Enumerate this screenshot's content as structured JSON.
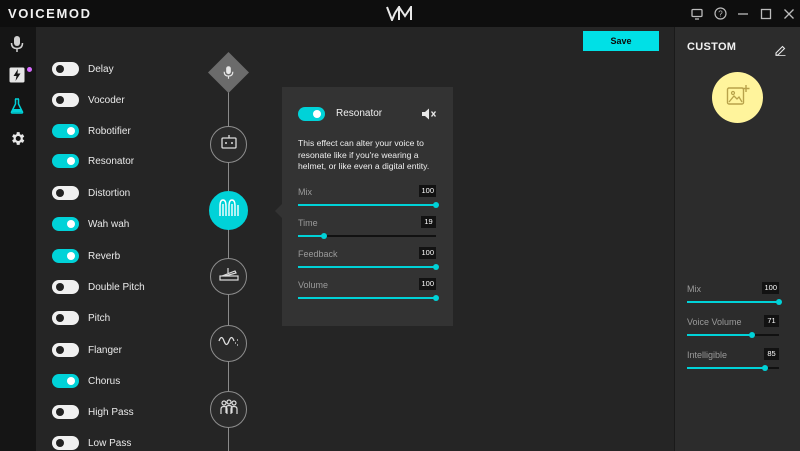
{
  "titlebar": {
    "brand": "VOICEMOD",
    "center_logo": "vm-logo-icon",
    "icons": [
      "screen-icon",
      "help-icon",
      "minimize-icon",
      "maximize-icon",
      "close-icon"
    ]
  },
  "rail": {
    "icons": [
      "microphone-icon",
      "soundboard-lightning-icon",
      "voicelab-flask-icon",
      "settings-gear-icon"
    ],
    "active": "voicelab-flask-icon"
  },
  "effects": [
    {
      "label": "Delay",
      "on": false
    },
    {
      "label": "Vocoder",
      "on": false
    },
    {
      "label": "Robotifier",
      "on": true
    },
    {
      "label": "Resonator",
      "on": true
    },
    {
      "label": "Distortion",
      "on": false
    },
    {
      "label": "Wah wah",
      "on": true
    },
    {
      "label": "Reverb",
      "on": true
    },
    {
      "label": "Double Pitch",
      "on": false
    },
    {
      "label": "Pitch",
      "on": false
    },
    {
      "label": "Flanger",
      "on": false
    },
    {
      "label": "Chorus",
      "on": true
    },
    {
      "label": "High Pass",
      "on": false
    },
    {
      "label": "Low Pass",
      "on": false
    }
  ],
  "chain": {
    "nodes": [
      "microphone-icon",
      "robot-icon",
      "resonator-icon",
      "wah-pedal-icon",
      "reverb-wave-icon",
      "chorus-people-icon"
    ],
    "active": "resonator-icon"
  },
  "popover": {
    "toggle_on": true,
    "title": "Resonator",
    "mute_icon": "speaker-mute-icon",
    "description": "This effect can alter your voice to resonate like if you're wearing a helmet, or like even a digital entity.",
    "sliders": [
      {
        "label": "Mix",
        "value": "100",
        "fraction": 1.0
      },
      {
        "label": "Time",
        "value": "19",
        "fraction": 0.19
      },
      {
        "label": "Feedback",
        "value": "100",
        "fraction": 1.0
      },
      {
        "label": "Volume",
        "value": "100",
        "fraction": 1.0
      }
    ]
  },
  "save_label": "Save",
  "right_panel": {
    "title": "CUSTOM",
    "edit_icon": "edit-pencil-icon",
    "avatar_icon": "add-image-icon",
    "avatar_color": "#fff49c",
    "sliders": [
      {
        "label": "Mix",
        "value": "100",
        "fraction": 1.0
      },
      {
        "label": "Voice Volume",
        "value": "71",
        "fraction": 0.71
      },
      {
        "label": "Intelligible",
        "value": "85",
        "fraction": 0.85
      }
    ]
  },
  "colors": {
    "accent": "#00d2d8",
    "save_button": "#00e0e6",
    "background": "#252525",
    "rail": "#151515",
    "titlebar": "#0e0e0e"
  }
}
